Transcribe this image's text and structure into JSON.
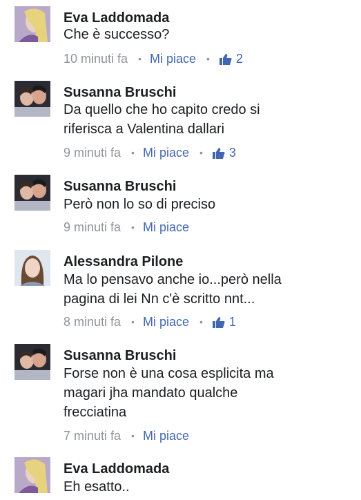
{
  "comments": [
    {
      "name": "Eva Laddomada",
      "text": "Che è successo?",
      "time": "10 minuti fa",
      "like_label": "Mi piace",
      "likes": "2",
      "avatar": "woman-blonde"
    },
    {
      "name": "Susanna Bruschi",
      "text": "Da quello che ho capito credo si\nriferisca a Valentina dallari",
      "time": "9 minuti fa",
      "like_label": "Mi piace",
      "likes": "3",
      "avatar": "couple"
    },
    {
      "name": "Susanna Bruschi",
      "text": "Però non lo so di preciso",
      "time": "9 minuti fa",
      "like_label": "Mi piace",
      "likes": "",
      "avatar": "couple"
    },
    {
      "name": "Alessandra Pilone",
      "text": "Ma lo pensavo anche io...però nella\npagina di lei Nn c'è scritto nnt...",
      "time": "8 minuti fa",
      "like_label": "Mi piace",
      "likes": "1",
      "avatar": "woman-brunette"
    },
    {
      "name": "Susanna Bruschi",
      "text": "Forse non è una cosa esplicita ma\nmagari jha mandato qualche\nfrecciatina",
      "time": "7 minuti fa",
      "like_label": "Mi piace",
      "likes": "",
      "avatar": "couple"
    },
    {
      "name": "Eva Laddomada",
      "text": "Eh esatto..",
      "time": "",
      "like_label": "",
      "likes": "",
      "avatar": "woman-blonde"
    }
  ],
  "colors": {
    "link": "#4267b2",
    "meta": "#90949c",
    "text": "#1c1e21"
  }
}
